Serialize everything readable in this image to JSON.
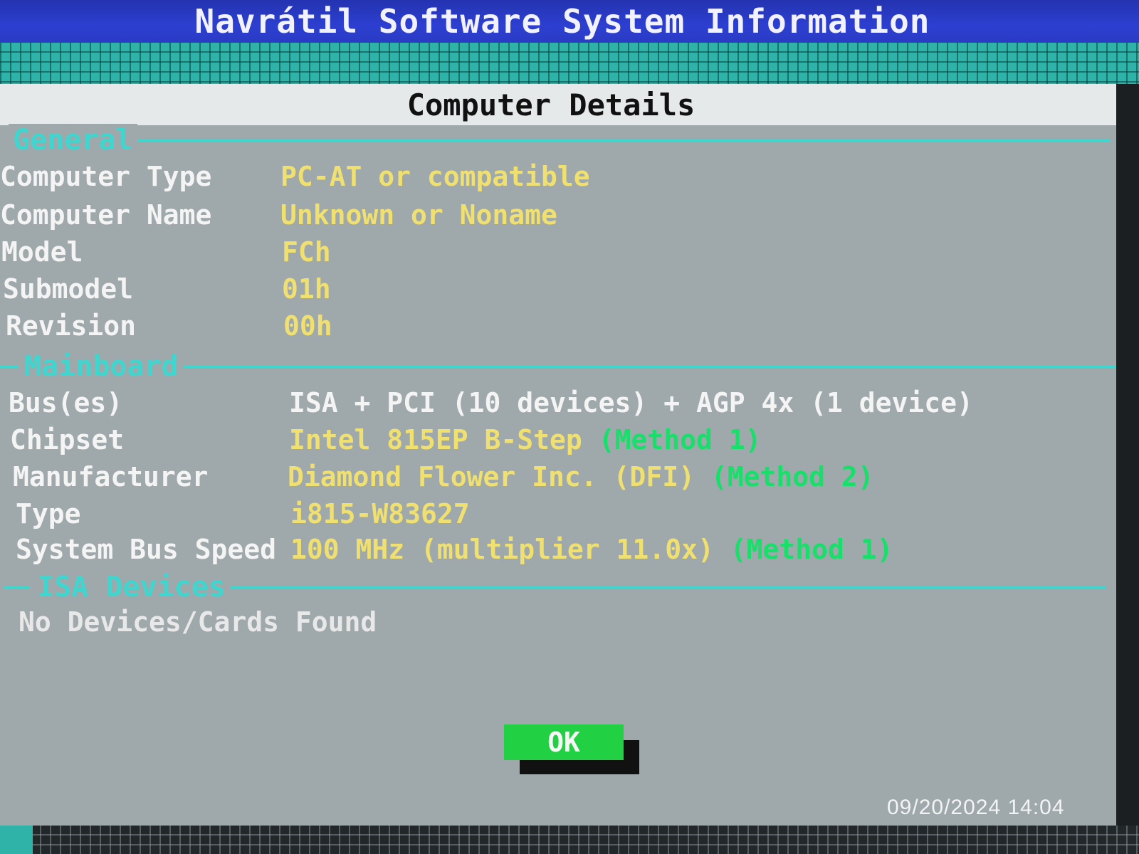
{
  "app_title": "Navrátil Software System Information",
  "window_title": "Computer Details",
  "sections": {
    "general": {
      "heading": "General",
      "rows": [
        {
          "label": "Computer Type",
          "value": "PC-AT or compatible"
        },
        {
          "label": "Computer Name",
          "value": "Unknown or Noname"
        },
        {
          "label": "Model",
          "value": "FCh"
        },
        {
          "label": "Submodel",
          "value": "01h"
        },
        {
          "label": "Revision",
          "value": "00h"
        }
      ]
    },
    "mainboard": {
      "heading": "Mainboard",
      "rows": [
        {
          "label": "Bus(es)",
          "value": "ISA + PCI (10 devices) + AGP 4x (1 device)"
        },
        {
          "label": "Chipset",
          "value": "Intel 815EP B-Step",
          "method": "(Method 1)"
        },
        {
          "label": "Manufacturer",
          "value": "Diamond Flower Inc. (DFI)",
          "method": "(Method 2)"
        },
        {
          "label": "Type",
          "value": "i815-W83627"
        },
        {
          "label": "System Bus Speed",
          "value": "100 MHz (multiplier 11.0x)",
          "method": "(Method 1)"
        }
      ]
    },
    "isa": {
      "heading": "ISA Devices",
      "empty_text": "No Devices/Cards Found"
    }
  },
  "ok_label": "OK",
  "photo_timestamp": "09/20/2024  14:04",
  "colors": {
    "title_bar": "#2c3fd0",
    "section_heading": "#3fd6cf",
    "value_text": "#f0e070",
    "method_text": "#17e06a",
    "ok_button": "#22d044",
    "window_bg": "#9fa8aa"
  }
}
